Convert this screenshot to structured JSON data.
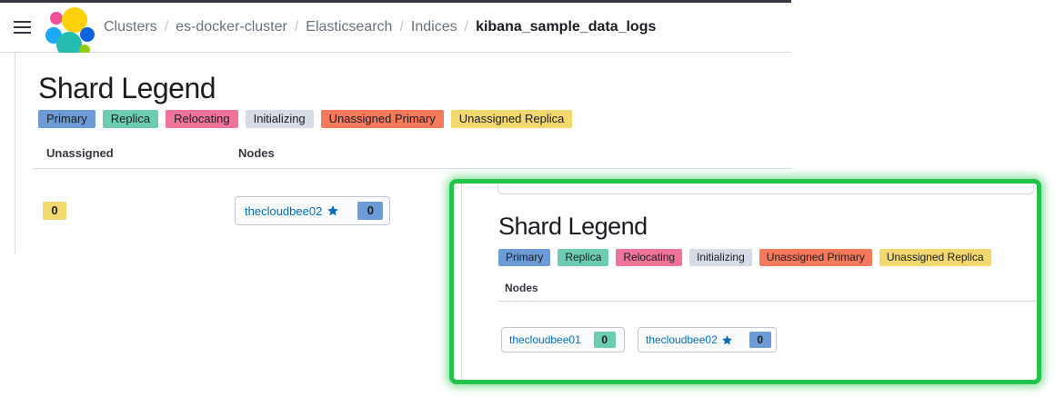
{
  "breadcrumbs": [
    "Clusters",
    "es-docker-cluster",
    "Elasticsearch",
    "Indices",
    "kibana_sample_data_logs"
  ],
  "main": {
    "title": "Shard Legend",
    "legend": [
      "Primary",
      "Replica",
      "Relocating",
      "Initializing",
      "Unassigned Primary",
      "Unassigned Replica"
    ],
    "columns": {
      "unassigned": "Unassigned",
      "nodes": "Nodes"
    },
    "unassigned_count": "0",
    "nodes": [
      {
        "name": "thecloudbee02",
        "count": "0"
      }
    ]
  },
  "inset": {
    "title": "Shard Legend",
    "legend": [
      "Primary",
      "Replica",
      "Relocating",
      "Initializing",
      "Unassigned Primary",
      "Unassigned Replica"
    ],
    "columns": {
      "nodes": "Nodes"
    },
    "nodes": [
      {
        "name": "thecloudbee01",
        "count": "0"
      },
      {
        "name": "thecloudbee02",
        "count": "0"
      }
    ]
  },
  "colors": {
    "primary": "#6c9bd6",
    "replica": "#6dccb1",
    "relocating": "#f0739a",
    "initializing": "#d6dbe5",
    "unassigned_primary": "#f6795b",
    "unassigned_replica": "#f1d86f",
    "highlight": "#22c44a",
    "node_link": "#006bb8"
  },
  "icons": {
    "menu": "hamburger-icon",
    "logo": "elastic-logo",
    "master": "star-icon"
  }
}
